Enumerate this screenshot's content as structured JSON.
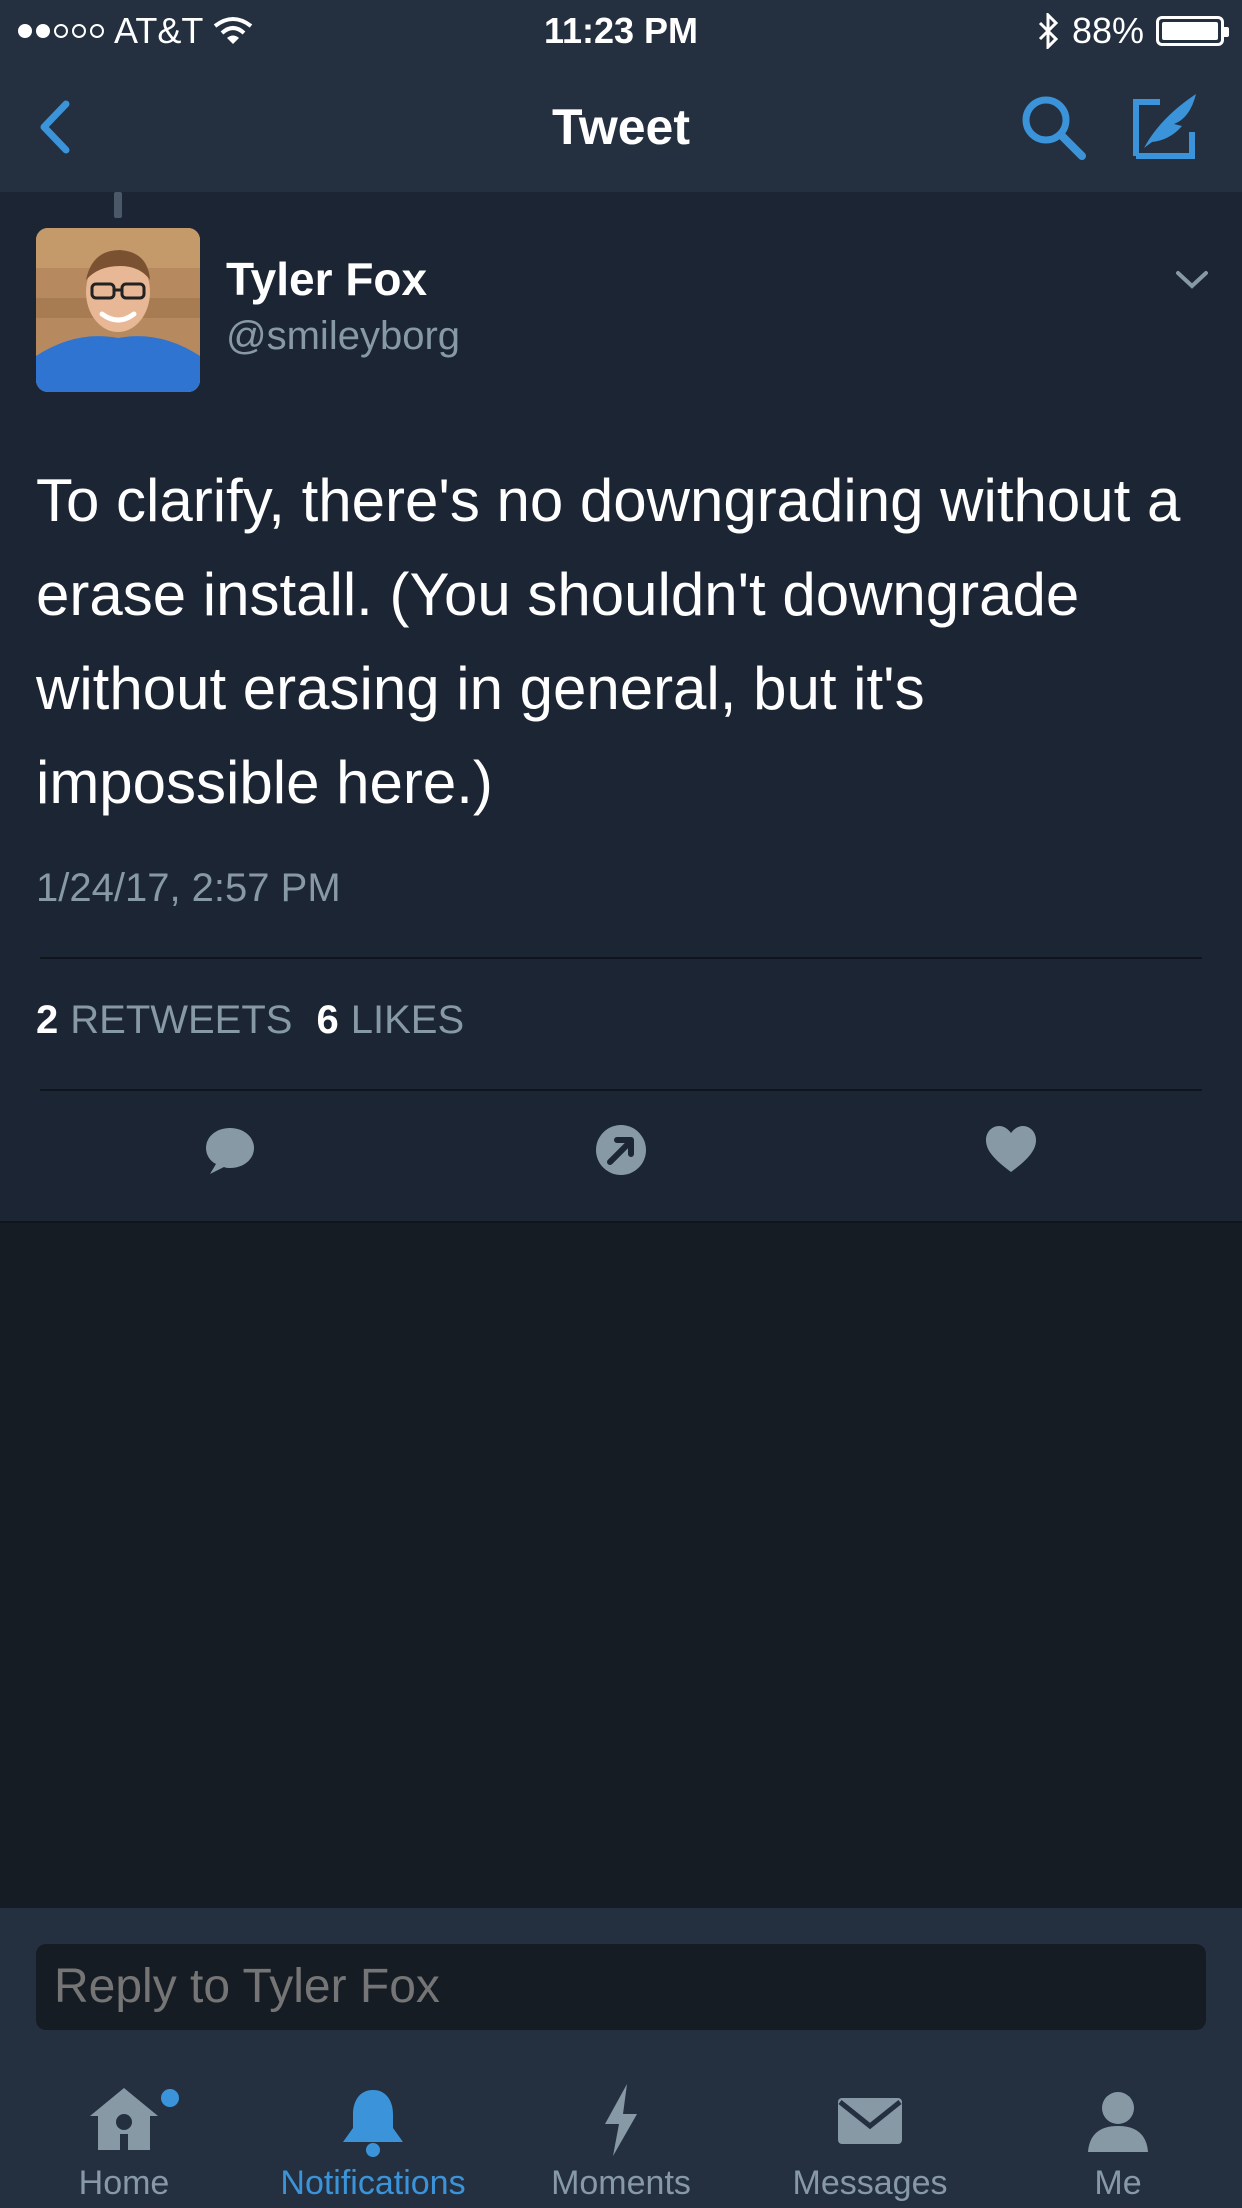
{
  "status_bar": {
    "carrier": "AT&T",
    "time": "11:23 PM",
    "battery": "88%",
    "signal_bars_filled": 2,
    "signal_bars_total": 5,
    "battery_level": 0.88
  },
  "nav": {
    "title": "Tweet"
  },
  "tweet": {
    "author_name": "Tyler Fox",
    "author_handle": "@smileyborg",
    "text": "To clarify, there's no downgrading without a erase install. (You shouldn't downgrade without erasing in general, but it's impossible here.)",
    "timestamp": "1/24/17, 2:57 PM",
    "retweets_count": "2",
    "retweets_label": "RETWEETS",
    "likes_count": "6",
    "likes_label": "LIKES"
  },
  "reply": {
    "placeholder": "Reply to Tyler Fox"
  },
  "tabs": [
    {
      "label": "Home",
      "icon": "home-icon",
      "active": false,
      "has_badge": true
    },
    {
      "label": "Notifications",
      "icon": "bell-icon",
      "active": true,
      "has_badge": false
    },
    {
      "label": "Moments",
      "icon": "lightning-icon",
      "active": false,
      "has_badge": false
    },
    {
      "label": "Messages",
      "icon": "envelope-icon",
      "active": false,
      "has_badge": false
    },
    {
      "label": "Me",
      "icon": "person-icon",
      "active": false,
      "has_badge": false
    }
  ],
  "colors": {
    "accent": "#3b94d9",
    "background": "#161c24",
    "card": "#1c2533",
    "bar": "#243040",
    "muted_text": "#8899a6"
  }
}
